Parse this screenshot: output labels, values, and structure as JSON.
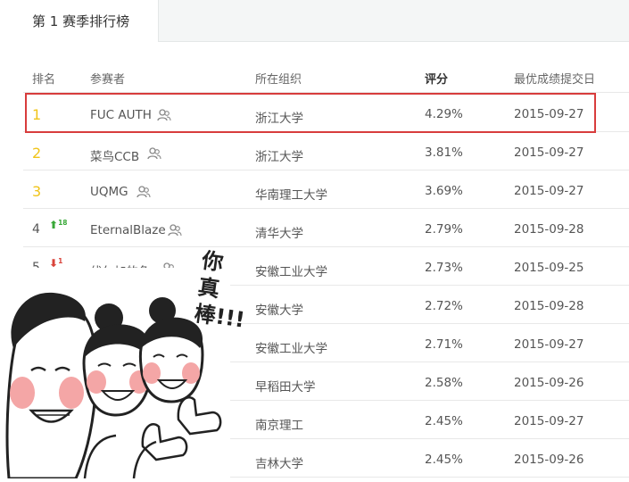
{
  "tab": {
    "label": "第 1 赛季排行榜"
  },
  "headers": {
    "rank": "排名",
    "participant": "参赛者",
    "org": "所在组织",
    "score": "评分",
    "date": "最优成绩提交日"
  },
  "rows": [
    {
      "rank": "1",
      "name": "FUC AUTH",
      "org": "浙江大学",
      "score": "4.29%",
      "date": "2015-09-27"
    },
    {
      "rank": "2",
      "name": "菜鸟CCB",
      "org": "浙江大学",
      "score": "3.81%",
      "date": "2015-09-27"
    },
    {
      "rank": "3",
      "name": "UQMG",
      "org": "华南理工大学",
      "score": "3.69%",
      "date": "2015-09-27"
    },
    {
      "rank": "4",
      "name": "EternalBlaze",
      "org": "清华大学",
      "score": "2.79%",
      "date": "2015-09-28",
      "trend": "up",
      "change": "18"
    },
    {
      "rank": "5",
      "name": "伏尔加的鱼",
      "org": "安徽工业大学",
      "score": "2.73%",
      "date": "2015-09-25",
      "trend": "down",
      "change": "1"
    },
    {
      "rank": "",
      "name": "",
      "org": "安徽大学",
      "score": "2.72%",
      "date": "2015-09-28"
    },
    {
      "rank": "",
      "name": "",
      "org": "安徽工业大学",
      "score": "2.71%",
      "date": "2015-09-27"
    },
    {
      "rank": "",
      "name": "",
      "org": "早稻田大学",
      "score": "2.58%",
      "date": "2015-09-26"
    },
    {
      "rank": "",
      "name": "",
      "org": "南京理工",
      "score": "2.45%",
      "date": "2015-09-27"
    },
    {
      "rank": "",
      "name": "",
      "org": "吉林大学",
      "score": "2.45%",
      "date": "2015-09-26"
    }
  ],
  "sticker": {
    "caption": "你真棒!!!"
  },
  "colors": {
    "highlight": "#d83c3c",
    "gold_rank": "#f0c419",
    "trend_up": "#39a838",
    "trend_down": "#d9443b"
  },
  "icons": {
    "team": "team-people-icon",
    "up": "arrow-up-icon",
    "down": "arrow-down-icon"
  }
}
